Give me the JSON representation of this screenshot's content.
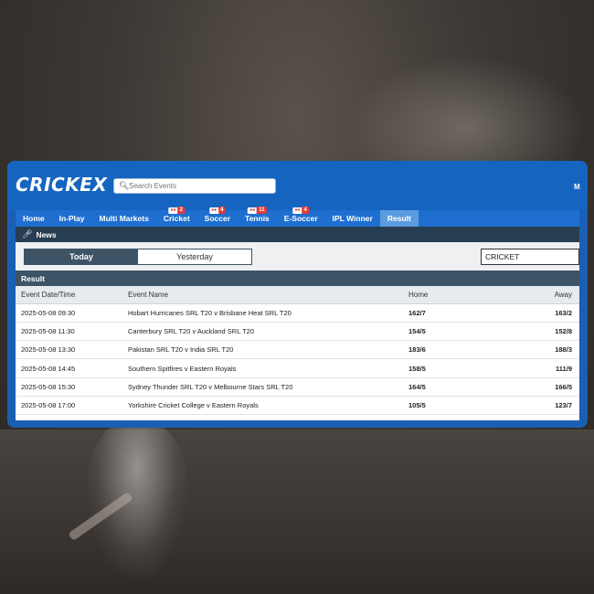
{
  "app": {
    "logo": "CRICKEX",
    "search_placeholder": "Search Events",
    "right_label": "M"
  },
  "nav": {
    "items": [
      {
        "label": "Home"
      },
      {
        "label": "In-Play"
      },
      {
        "label": "Multi Markets"
      },
      {
        "label": "Cricket",
        "badge": "2"
      },
      {
        "label": "Soccer",
        "badge": "4"
      },
      {
        "label": "Tennis",
        "badge": "11"
      },
      {
        "label": "E-Soccer",
        "badge": "4"
      },
      {
        "label": "IPL Winner"
      },
      {
        "label": "Result",
        "active": true
      }
    ]
  },
  "news": {
    "label": "News"
  },
  "filters": {
    "tabs": [
      {
        "label": "Today",
        "active": true
      },
      {
        "label": "Yesterday",
        "active": false
      }
    ],
    "sport": "CRICKET"
  },
  "result": {
    "title": "Result",
    "columns": [
      "Event Date/Time",
      "Event Name",
      "Home",
      "Away"
    ],
    "rows": [
      {
        "date": "2025-05-08 09:30",
        "name": "Hobart Hurricanes SRL T20 v Brisbane Heat SRL T20",
        "home": "162/7",
        "away": "163/2"
      },
      {
        "date": "2025-05-08 11:30",
        "name": "Canterbury SRL T20 v Auckland SRL T20",
        "home": "154/5",
        "away": "152/8"
      },
      {
        "date": "2025-05-08 13:30",
        "name": "Pakistan SRL T20 v India SRL T20",
        "home": "183/6",
        "away": "188/3"
      },
      {
        "date": "2025-05-08 14:45",
        "name": "Southern Spitfires v Eastern Royals",
        "home": "158/5",
        "away": "111/9"
      },
      {
        "date": "2025-05-08 15:30",
        "name": "Sydney Thunder SRL T20 v Melbourne Stars SRL T20",
        "home": "164/5",
        "away": "166/5"
      },
      {
        "date": "2025-05-08 17:00",
        "name": "Yorkshire Cricket College v Eastern Royals",
        "home": "105/5",
        "away": "123/7"
      }
    ]
  }
}
